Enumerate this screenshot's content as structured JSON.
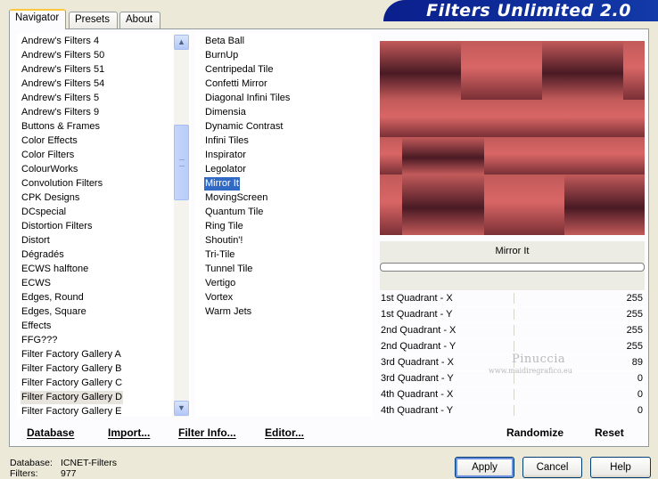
{
  "tabs": [
    {
      "label": "Navigator",
      "active": true
    },
    {
      "label": "Presets",
      "active": false
    },
    {
      "label": "About",
      "active": false
    }
  ],
  "header": {
    "title": "Filters Unlimited 2.0",
    "color": "#0a1f8c"
  },
  "categories": [
    "Andrew's Filters 4",
    "Andrew's Filters 50",
    "Andrew's Filters 51",
    "Andrew's Filters 54",
    "Andrew's Filters 5",
    "Andrew's Filters 9",
    "Buttons & Frames",
    "Color Effects",
    "Color Filters",
    "ColourWorks",
    "Convolution Filters",
    "CPK Designs",
    "DCspecial",
    "Distortion Filters",
    "Distort",
    "Dégradés",
    "ECWS halftone",
    "ECWS",
    "Edges, Round",
    "Edges, Square",
    "Effects",
    "FFG???",
    "Filter Factory Gallery A",
    "Filter Factory Gallery B",
    "Filter Factory Gallery C",
    "Filter Factory Gallery D",
    "Filter Factory Gallery E"
  ],
  "selected_category": "Filter Factory Gallery D",
  "filters": [
    "Beta Ball",
    "BurnUp",
    "Centripedal Tile",
    "Confetti Mirror",
    "Diagonal Infini Tiles",
    "Dimensia",
    "Dynamic Contrast",
    "Infini Tiles",
    "Inspirator",
    "Legolator",
    "Mirror It",
    "MovingScreen",
    "Quantum Tile",
    "Ring Tile",
    "Shoutin'!",
    "Tri-Tile",
    "Tunnel Tile",
    "Vertigo",
    "Vortex",
    "Warm Jets"
  ],
  "selected_filter": "Mirror It",
  "scroll": {
    "up_icon": "▲",
    "down_icon": "▼"
  },
  "preview": {
    "base_color": "#c25a5a",
    "dark_color": "#4a1a24"
  },
  "filter_panel": {
    "name": "Mirror It"
  },
  "params": [
    {
      "label": "1st Quadrant - X",
      "value": "255"
    },
    {
      "label": "1st Quadrant - Y",
      "value": "255"
    },
    {
      "label": "2nd Quadrant - X",
      "value": "255"
    },
    {
      "label": "2nd Quadrant - Y",
      "value": "255"
    },
    {
      "label": "3rd Quadrant - X",
      "value": "89"
    },
    {
      "label": "3rd Quadrant - Y",
      "value": "0"
    },
    {
      "label": "4th Quadrant - X",
      "value": "0"
    },
    {
      "label": "4th Quadrant - Y",
      "value": "0"
    }
  ],
  "watermark": {
    "line1": "Pinuccia",
    "line2": "www.maidiregrafico.eu"
  },
  "bottom_links": {
    "database": "Database",
    "import": "Import...",
    "filter_info": "Filter Info...",
    "editor": "Editor...",
    "randomize": "Randomize",
    "reset": "Reset"
  },
  "status": {
    "database_label": "Database:",
    "database_value": "ICNET-Filters",
    "filters_label": "Filters:",
    "filters_value": "977"
  },
  "buttons": {
    "apply": "Apply",
    "cancel": "Cancel",
    "help": "Help"
  }
}
